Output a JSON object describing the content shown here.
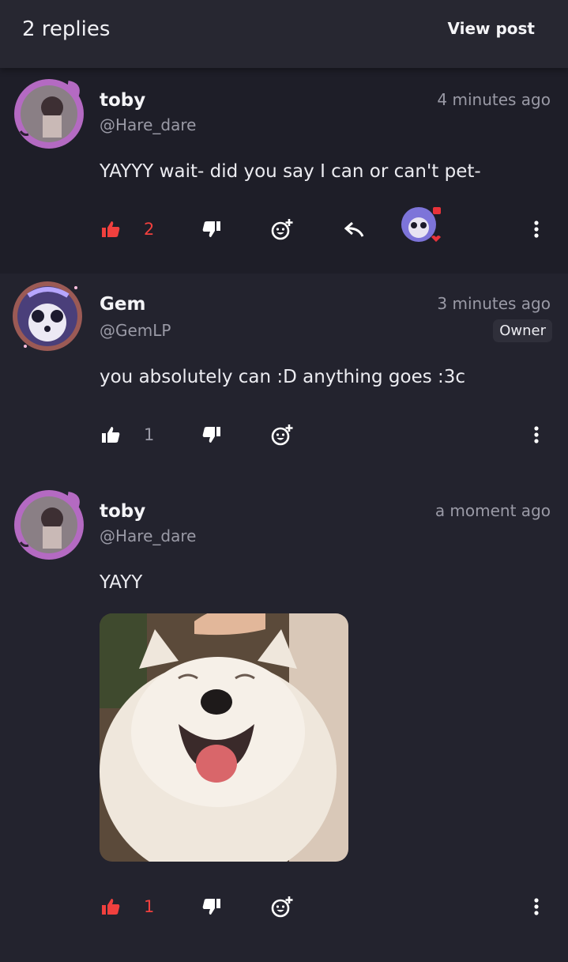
{
  "header": {
    "title": "2 replies",
    "view_post": "View post"
  },
  "comments": [
    {
      "name": "toby",
      "handle": "@Hare_dare",
      "time": "4 minutes ago",
      "text": "YAYYY wait- did you say I can or can't pet-",
      "likes": "2",
      "liked": true
    },
    {
      "name": "Gem",
      "handle": "@GemLP",
      "time": "3 minutes ago",
      "badge": "Owner",
      "text": "you absolutely can :D anything goes :3c",
      "likes": "1",
      "liked": false
    },
    {
      "name": "toby",
      "handle": "@Hare_dare",
      "time": "a moment ago",
      "text": "YAYY",
      "likes": "1",
      "liked": true
    }
  ],
  "colors": {
    "accent_red": "#f0403e",
    "background": "#23232e",
    "header": "#272731",
    "muted": "#9a9aa6"
  },
  "icons": [
    "thumbs-up-icon",
    "thumbs-down-icon",
    "add-reaction-icon",
    "reply-icon",
    "more-vertical-icon"
  ]
}
